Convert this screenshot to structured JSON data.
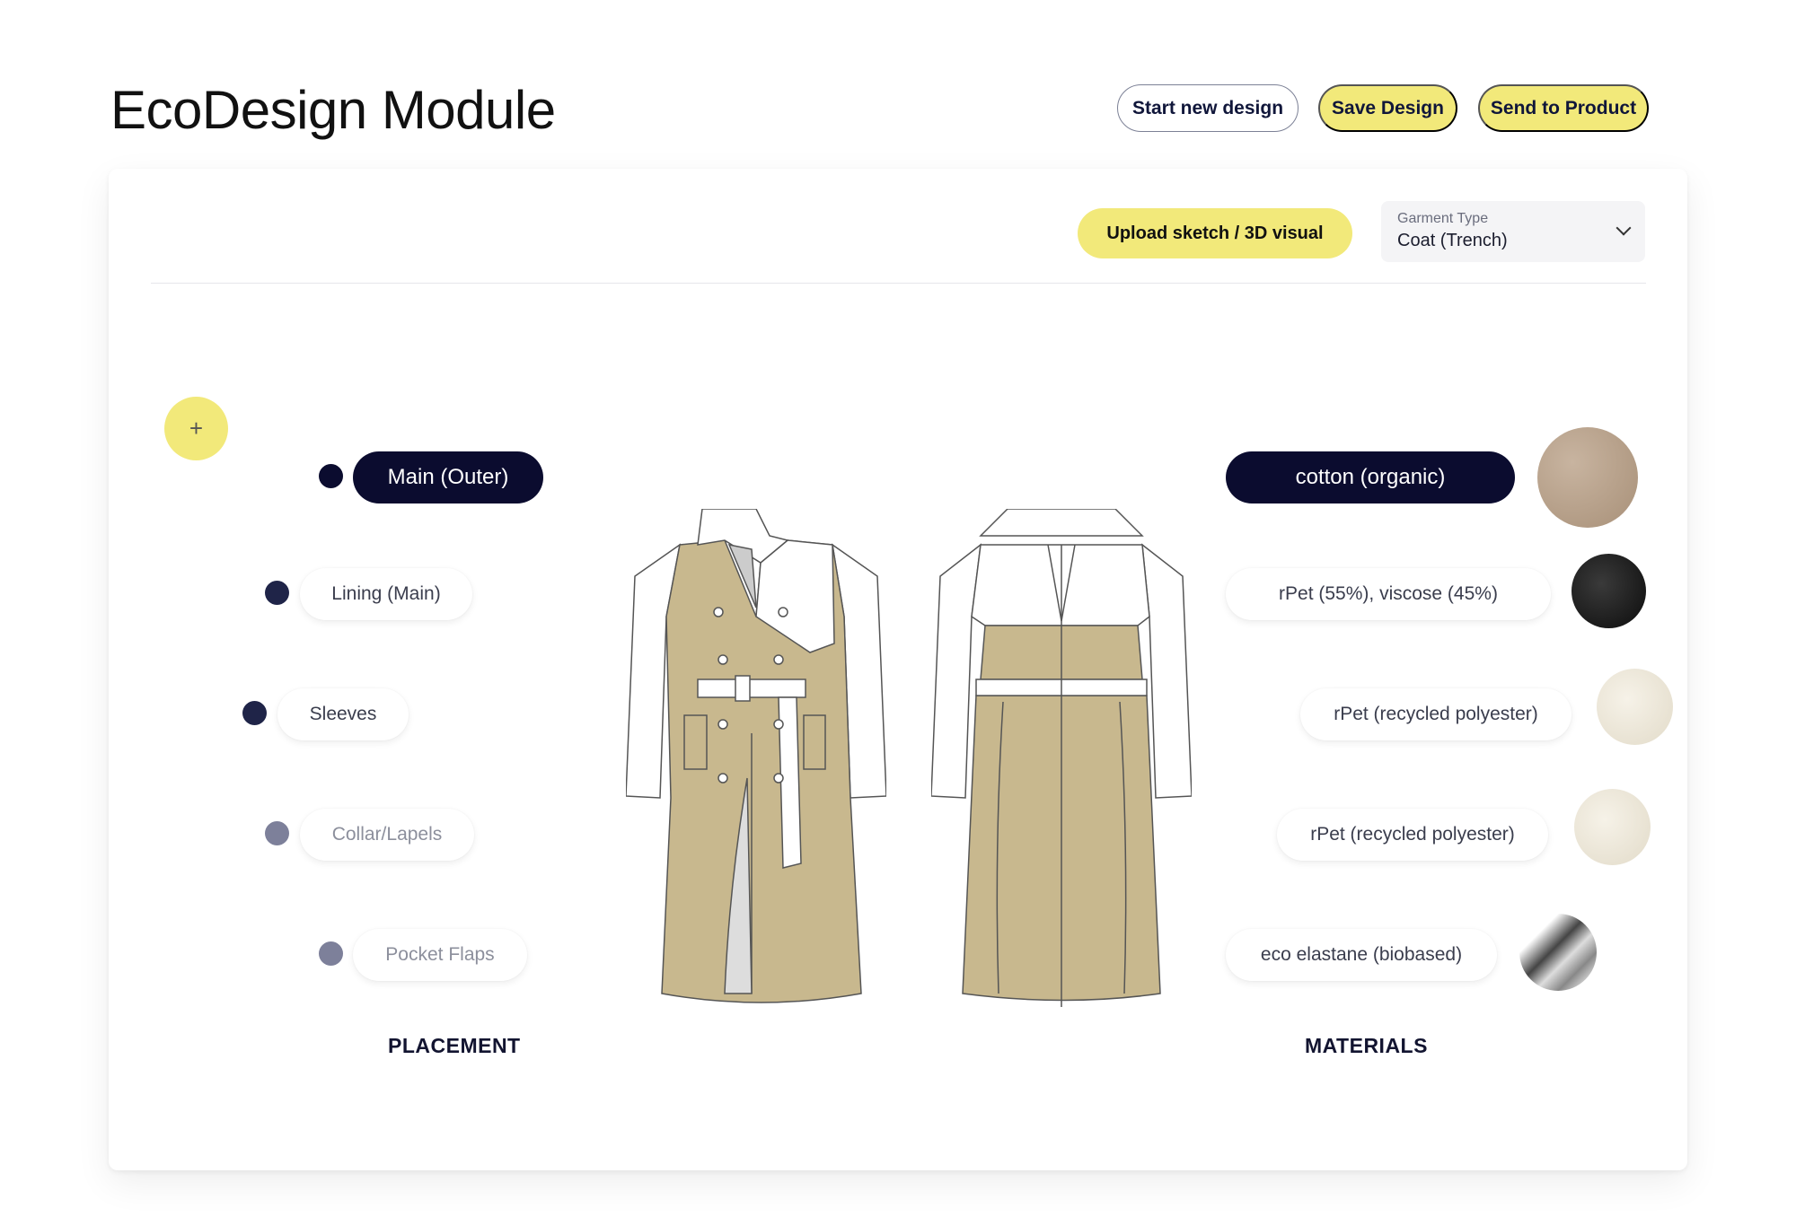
{
  "header": {
    "title": "EcoDesign Module",
    "start_new": "Start new design",
    "save": "Save Design",
    "send": "Send to Product"
  },
  "toolbar": {
    "upload": "Upload sketch / 3D visual",
    "garment_type_label": "Garment Type",
    "garment_type_value": "Coat (Trench)"
  },
  "add_button": "+",
  "placement": {
    "label": "PLACEMENT",
    "items": [
      {
        "label": "Main (Outer)"
      },
      {
        "label": "Lining (Main)"
      },
      {
        "label": "Sleeves"
      },
      {
        "label": "Collar/Lapels"
      },
      {
        "label": "Pocket Flaps"
      }
    ]
  },
  "materials": {
    "label": "MATERIALS",
    "items": [
      {
        "label": "cotton (organic)"
      },
      {
        "label": "rPet (55%), viscose (45%)"
      },
      {
        "label": "rPet (recycled polyester)"
      },
      {
        "label": "rPet (recycled polyester)"
      },
      {
        "label": "eco elastane (biobased)"
      }
    ]
  },
  "colors": {
    "accent_yellow": "#f2e97a",
    "navy": "#0b0c2f",
    "coat_fabric": "#c8b88e"
  }
}
